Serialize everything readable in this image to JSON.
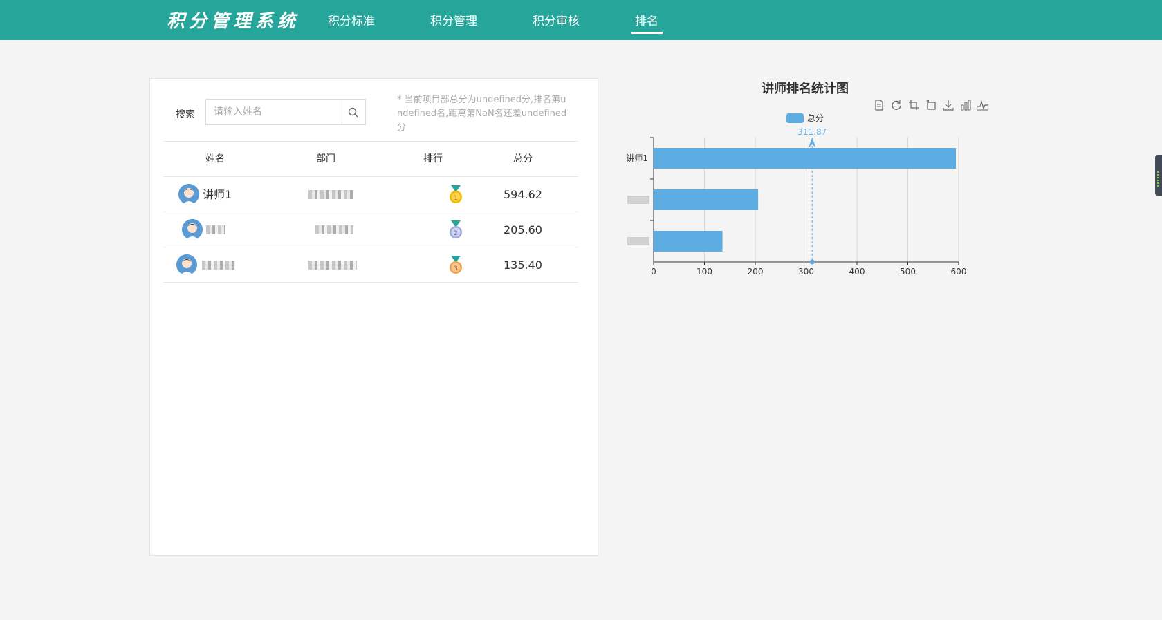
{
  "header": {
    "logo": "积分管理系统",
    "nav": [
      {
        "label": "积分标准",
        "active": false
      },
      {
        "label": "积分管理",
        "active": false
      },
      {
        "label": "积分审核",
        "active": false
      },
      {
        "label": "排名",
        "active": true
      }
    ]
  },
  "search": {
    "label": "搜索",
    "placeholder": "请输入姓名",
    "hint": "* 当前项目部总分为undefined分,排名第undefined名,距离第NaN名还差undefined分"
  },
  "table": {
    "columns": [
      "姓名",
      "部门",
      "排行",
      "总分"
    ],
    "rows": [
      {
        "name": "讲师1",
        "rank": "1",
        "score": "594.62"
      },
      {
        "name": "",
        "rank": "2",
        "score": "205.60"
      },
      {
        "name": "",
        "rank": "3",
        "score": "135.40"
      }
    ]
  },
  "chart_data": {
    "type": "bar",
    "orientation": "horizontal",
    "title": "讲师排名统计图",
    "categories": [
      "讲师1",
      "",
      ""
    ],
    "series": [
      {
        "name": "总分",
        "values": [
          594.62,
          205.6,
          135.4
        ],
        "color": "#5dade2"
      }
    ],
    "xlim": [
      0,
      600
    ],
    "xticks": [
      0,
      100,
      200,
      300,
      400,
      500,
      600
    ],
    "grid": true,
    "legend": "top",
    "average_line": {
      "value": 311.87,
      "label": "311.87",
      "color": "#5dade2"
    }
  },
  "toolbox": [
    "data-view-icon",
    "restore-icon",
    "zoom-icon",
    "zoom-reset-icon",
    "save-image-icon",
    "bar-chart-icon",
    "line-chart-icon"
  ],
  "colors": {
    "header": "#26a69a",
    "bar": "#5dade2",
    "gold": "#f5b800",
    "silver": "#9fa8da",
    "bronze": "#f0a050"
  }
}
